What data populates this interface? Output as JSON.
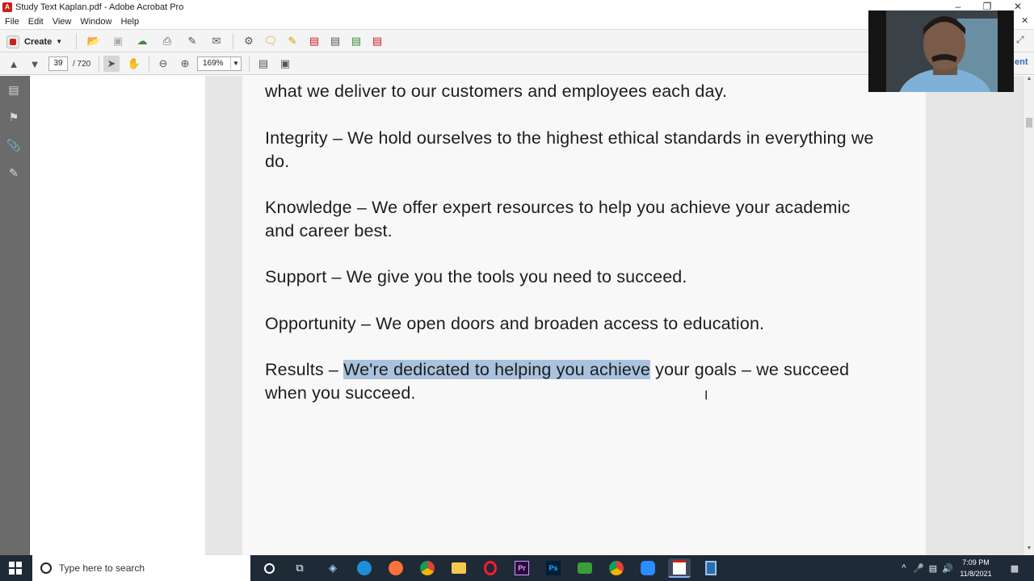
{
  "window": {
    "title": "Study Text Kaplan.pdf - Adobe Acrobat Pro"
  },
  "menu": [
    "File",
    "Edit",
    "View",
    "Window",
    "Help"
  ],
  "toolbar": {
    "create_label": "Create"
  },
  "nav": {
    "current_page": "39",
    "total_pages": "/ 720",
    "zoom": "169%"
  },
  "document": {
    "para1_line1": "what we deliver to our customers and employees each day.",
    "para2_line1": "Integrity – We hold ourselves to the highest ethical standards in everything we",
    "para2_line2": "do.",
    "para3_line1": "Knowledge – We offer expert resources to help you achieve your academic",
    "para3_line2": "and career best.",
    "para4": "Support – We give you the tools you need to succeed.",
    "para5": "Opportunity – We open doors and broaden access to education.",
    "para6_before": "Results – ",
    "para6_highlight": "We're dedicated to helping you achieve",
    "para6_after": " your goals – we succeed",
    "para6_line2": "when you succeed."
  },
  "right_pane": {
    "partial_label": "ent"
  },
  "taskbar": {
    "search_placeholder": "Type here to search",
    "time": "7:09 PM",
    "date": "11/8/2021"
  }
}
